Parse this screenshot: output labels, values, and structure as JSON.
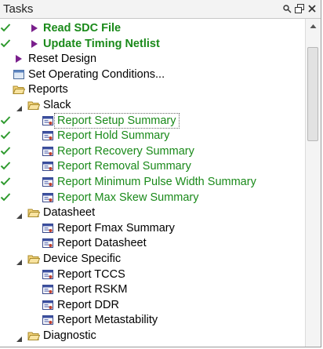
{
  "panel": {
    "title": "Tasks",
    "title_icons": [
      "pin-icon",
      "restore-icon",
      "close-icon"
    ]
  },
  "colors": {
    "done_text": "#1a8a1a",
    "check": "#2e9a2e",
    "run_arrow": "#7a1f8c"
  },
  "tree": [
    {
      "label": "Read SDC File",
      "icon": "run-arrow-icon",
      "checked": true,
      "bold": true,
      "green": true
    },
    {
      "label": "Update Timing Netlist",
      "icon": "run-arrow-icon",
      "checked": true,
      "bold": true,
      "green": true
    },
    {
      "label": "Reset Design",
      "icon": "run-arrow-icon",
      "checked": false
    },
    {
      "label": "Set Operating Conditions...",
      "icon": "window-icon",
      "checked": false
    },
    {
      "label": "Reports",
      "icon": "folder-open-icon",
      "checked": false
    },
    {
      "label": "Slack",
      "icon": "folder-open-icon",
      "expanded": true
    },
    {
      "label": "Report Setup Summary",
      "icon": "report-icon",
      "checked": true,
      "green": true,
      "selected": true
    },
    {
      "label": "Report Hold Summary",
      "icon": "report-icon",
      "checked": true,
      "green": true
    },
    {
      "label": "Report Recovery Summary",
      "icon": "report-icon",
      "checked": true,
      "green": true
    },
    {
      "label": "Report Removal Summary",
      "icon": "report-icon",
      "checked": true,
      "green": true
    },
    {
      "label": "Report Minimum Pulse Width Summary",
      "icon": "report-icon",
      "checked": true,
      "green": true
    },
    {
      "label": "Report Max Skew Summary",
      "icon": "report-icon",
      "checked": true,
      "green": true
    },
    {
      "label": "Datasheet",
      "icon": "folder-open-icon",
      "expanded": true
    },
    {
      "label": "Report Fmax Summary",
      "icon": "report-icon"
    },
    {
      "label": "Report Datasheet",
      "icon": "report-icon"
    },
    {
      "label": "Device Specific",
      "icon": "folder-open-icon",
      "expanded": true
    },
    {
      "label": "Report TCCS",
      "icon": "report-icon"
    },
    {
      "label": "Report RSKM",
      "icon": "report-icon"
    },
    {
      "label": "Report DDR",
      "icon": "report-icon"
    },
    {
      "label": "Report Metastability",
      "icon": "report-icon"
    },
    {
      "label": "Diagnostic",
      "icon": "folder-open-icon",
      "expanded": true
    }
  ]
}
